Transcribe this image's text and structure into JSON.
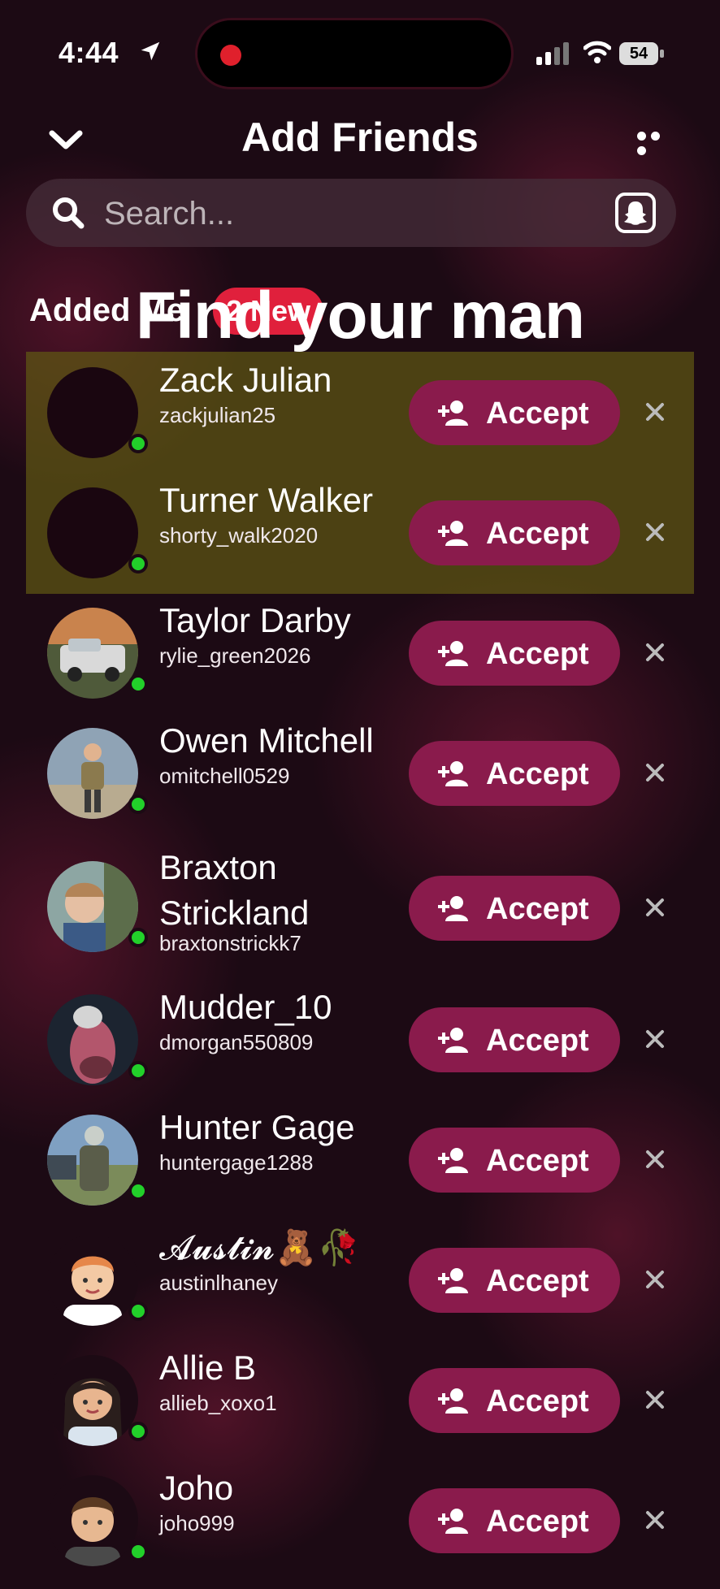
{
  "status_bar": {
    "time": "4:44",
    "battery": "54"
  },
  "header": {
    "title": "Add Friends"
  },
  "search": {
    "placeholder": "Search..."
  },
  "section": {
    "label": "Added Me",
    "badge": "2 New"
  },
  "overlay": {
    "caption": "Find your man"
  },
  "requests": [
    {
      "name": "Zack Julian",
      "username": "zackjulian25",
      "avatar": "empty",
      "highlighted": true
    },
    {
      "name": "Turner Walker",
      "username": "shorty_walk2020",
      "avatar": "empty",
      "highlighted": true
    },
    {
      "name": "Taylor Darby",
      "username": "rylie_green2026",
      "avatar": "truck-photo"
    },
    {
      "name": "Owen Mitchell",
      "username": "omitchell0529",
      "avatar": "person-photo"
    },
    {
      "name": "Braxton",
      "name2": "Strickland",
      "username": "braxtonstrickk7",
      "avatar": "selfie-photo"
    },
    {
      "name": "Mudder_10",
      "username": "dmorgan550809",
      "avatar": "turkey-photo"
    },
    {
      "name": "Hunter Gage",
      "username": "huntergage1288",
      "avatar": "hunter-photo"
    },
    {
      "name": "𝓐𝓾𝓼𝓽𝓲𝓷🧸🥀",
      "username": "austinlhaney",
      "avatar": "bitmoji-male"
    },
    {
      "name": "Allie B",
      "username": "allieb_xoxo1",
      "avatar": "bitmoji-female"
    },
    {
      "name": "Joho",
      "username": "joho999",
      "avatar": "bitmoji-male-2"
    }
  ],
  "actions": {
    "accept_label": "Accept"
  },
  "colors": {
    "accent": "#8a1b4c",
    "online": "#22d02a",
    "badge": "#e0203c",
    "highlight": "#5f5814"
  }
}
